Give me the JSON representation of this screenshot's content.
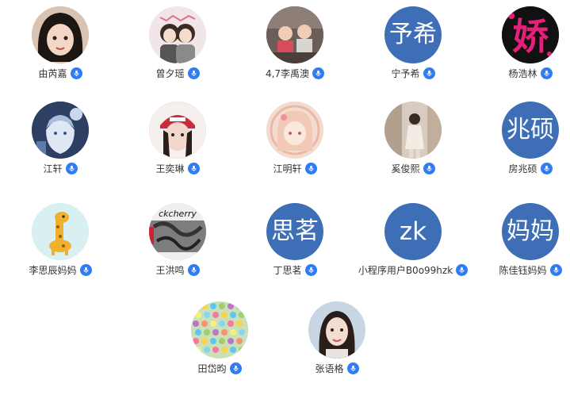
{
  "colors": {
    "initials_bg": "#3e6eb6",
    "badge": "#2f7df6"
  },
  "members": [
    {
      "name": "由芮嘉",
      "avatar": "photo",
      "photo_desc": "child-portrait-dark-hair",
      "bg": "#d9c3b2",
      "badge": "mic-icon"
    },
    {
      "name": "曾夕瑶",
      "avatar": "photo",
      "photo_desc": "cartoon-couple",
      "bg": "#f2e5e8",
      "badge": "mic-icon"
    },
    {
      "name": "4,7李禹澳",
      "avatar": "photo",
      "photo_desc": "kids-at-table",
      "bg": "#6b5e58",
      "badge": "mic-icon"
    },
    {
      "name": "宁予希",
      "avatar": "initials",
      "initials": "予希",
      "badge": "mic-icon"
    },
    {
      "name": "杨浩林",
      "avatar": "photo",
      "photo_desc": "pink-character-on-black",
      "glyph": "娇",
      "bg": "#111111",
      "badge": "mic-icon"
    },
    {
      "name": "江轩",
      "avatar": "photo",
      "photo_desc": "anime-boy-night",
      "bg": "#4b6a92",
      "badge": "mic-icon"
    },
    {
      "name": "王奕琳",
      "avatar": "photo",
      "photo_desc": "girl-red-cap",
      "bg": "#d84a57",
      "badge": "mic-icon"
    },
    {
      "name": "江明轩",
      "avatar": "photo",
      "photo_desc": "anime-girl-pastel",
      "bg": "#f3dccf",
      "badge": "mic-icon"
    },
    {
      "name": "奚俊熙",
      "avatar": "photo",
      "photo_desc": "girl-in-street",
      "bg": "#cbb8a8",
      "badge": "mic-icon"
    },
    {
      "name": "房兆硕",
      "avatar": "initials",
      "initials": "兆硕",
      "badge": "mic-icon"
    },
    {
      "name": "李思辰妈妈",
      "avatar": "photo",
      "photo_desc": "giraffe-cartoon",
      "bg": "#d9f0f2",
      "badge": "mic-icon"
    },
    {
      "name": "王洪鸣",
      "avatar": "photo",
      "photo_desc": "graffiti-bw",
      "caption": "ckcherry",
      "bg": "#9a9a9a",
      "badge": "mic-icon"
    },
    {
      "name": "丁思茗",
      "avatar": "initials",
      "initials": "思茗",
      "badge": "mic-icon"
    },
    {
      "name": "小程序用户B0o99hzk",
      "avatar": "initials",
      "initials": "zk",
      "latin": true,
      "badge": "mic-icon"
    },
    {
      "name": "陈佳钰妈妈",
      "avatar": "initials",
      "initials": "妈妈",
      "badge": "mic-icon"
    },
    {
      "name": "田岱昀",
      "avatar": "photo",
      "photo_desc": "colorful-candies",
      "bg": "#c9e0b8",
      "badge": "mic-icon"
    },
    {
      "name": "张语格",
      "avatar": "photo",
      "photo_desc": "woman-portrait",
      "bg": "#c8d6e4",
      "badge": "mic-icon"
    }
  ]
}
